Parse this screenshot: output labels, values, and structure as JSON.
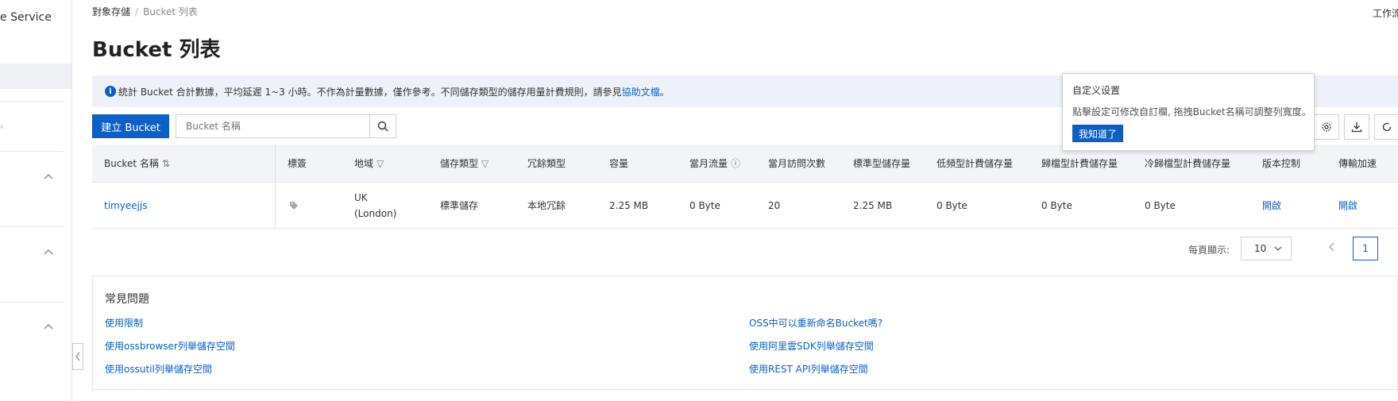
{
  "sidebar": {
    "service_title": "e Service"
  },
  "breadcrumb": {
    "root": "對象存儲",
    "current": "Bucket 列表"
  },
  "top_right": "工作流",
  "page_title": "Bucket 列表",
  "notice": {
    "text": "統計 Bucket 合計數據，平均延遲 1~3 小時。不作為計量數據，僅作參考。不同儲存類型的儲存用量計費規則，請參見",
    "link": "協助文檔",
    "tail": "。"
  },
  "toolbar": {
    "create_label": "建立 Bucket",
    "search_placeholder": "Bucket 名稱"
  },
  "popover": {
    "title": "自定义设置",
    "desc": "點擊設定可修改自訂欄, 拖拽Bucket名稱可調整列寬度。",
    "button": "我知道了"
  },
  "table": {
    "headers": [
      "Bucket 名稱",
      "標簽",
      "地域",
      "儲存類型",
      "冗餘類型",
      "容量",
      "當月流量",
      "當月訪問次數",
      "標準型儲存量",
      "低頻型計費儲存量",
      "歸檔型計費儲存量",
      "冷歸檔型計費儲存量",
      "版本控制",
      "傳輸加速"
    ],
    "rows": [
      {
        "name": "timyeejjs",
        "region_line1": "UK",
        "region_line2": "(London)",
        "storage_type": "標準儲存",
        "redundancy": "本地冗餘",
        "capacity": "2.25 MB",
        "monthly_traffic": "0 Byte",
        "monthly_visits": "20",
        "standard_storage": "2.25 MB",
        "ia_storage": "0 Byte",
        "archive_storage": "0 Byte",
        "cold_archive_storage": "0 Byte",
        "versioning": "開啟",
        "transfer_acceleration": "開啟"
      }
    ]
  },
  "pagination": {
    "label": "每頁顯示:",
    "page_size": "10",
    "current_page": "1"
  },
  "faq": {
    "title": "常見問題",
    "links": [
      "使用限制",
      "使用ossbrowser列舉儲存空間",
      "使用ossutil列舉儲存空間",
      "OSS中可以重新命名Bucket嗎?",
      "使用阿里雲SDK列舉儲存空間",
      "使用REST API列舉儲存空間"
    ]
  },
  "colors": {
    "primary": "#0b5fc7",
    "header_bg": "#f2f4f7",
    "notice_bg": "#eef2f8"
  }
}
